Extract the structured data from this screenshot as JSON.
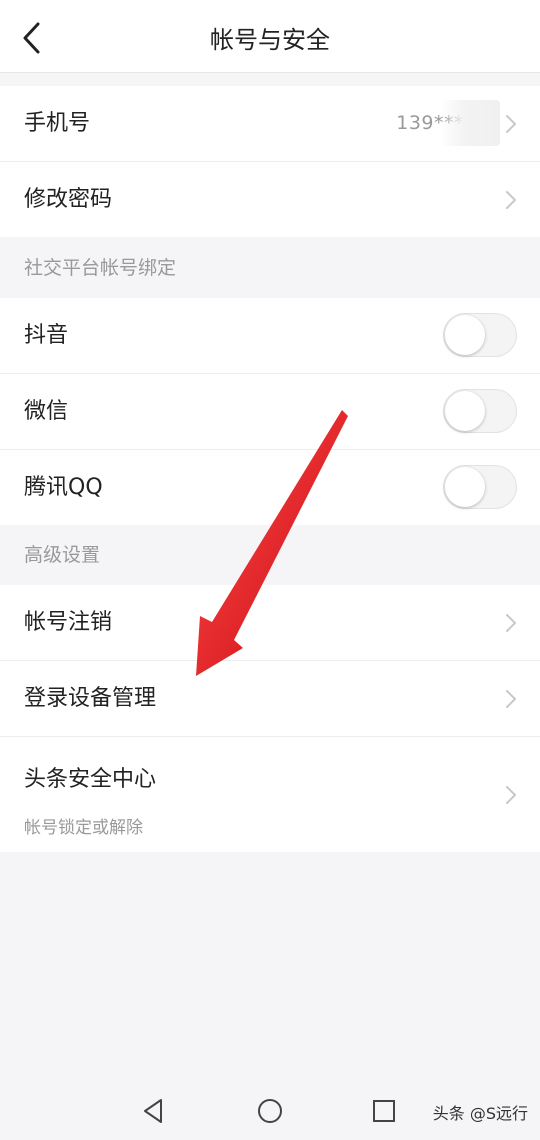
{
  "header": {
    "title": "帐号与安全",
    "back_icon": "chevron-left-icon"
  },
  "account": {
    "phone_label": "手机号",
    "phone_value": "139*****",
    "password_label": "修改密码"
  },
  "social": {
    "section_title": "社交平台帐号绑定",
    "items": [
      {
        "label": "抖音",
        "enabled": false
      },
      {
        "label": "微信",
        "enabled": false
      },
      {
        "label": "腾讯QQ",
        "enabled": false
      }
    ]
  },
  "advanced": {
    "section_title": "高级设置",
    "items": [
      {
        "label": "帐号注销"
      },
      {
        "label": "登录设备管理"
      },
      {
        "label": "头条安全中心",
        "sublabel": "帐号锁定或解除"
      }
    ]
  },
  "colors": {
    "annotation_arrow": "#e8141b",
    "background": "#f5f5f7",
    "secondary_text": "#999999"
  },
  "navbar": {
    "icons": [
      "nav-back-icon",
      "nav-home-icon",
      "nav-recents-icon"
    ]
  },
  "watermark": "头条 @S远行"
}
